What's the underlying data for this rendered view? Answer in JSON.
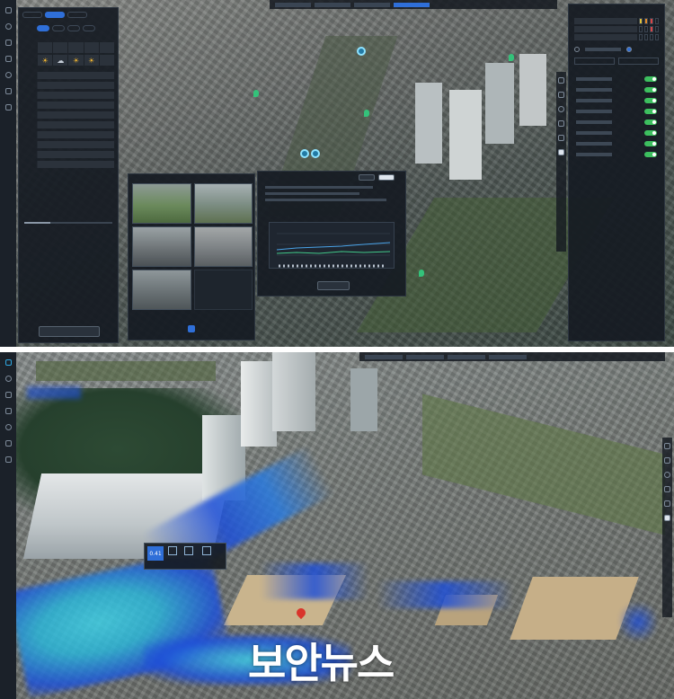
{
  "top_view": {
    "left_panel": {
      "tabs": [
        {
          "label": "",
          "active": false
        },
        {
          "label": "",
          "active": true
        },
        {
          "label": "",
          "active": false
        }
      ],
      "sub_tabs": [
        {
          "label": "",
          "active": true
        },
        {
          "label": "",
          "active": false
        },
        {
          "label": "",
          "active": false
        },
        {
          "label": "",
          "active": false
        }
      ],
      "weather_icons": [
        "sun-cloud-icon",
        "cloud-icon",
        "sun-cloud-icon",
        "sun-cloud-icon"
      ],
      "footer_button": ""
    },
    "cctv_popup": {
      "title": "",
      "cameras": [
        {
          "label": ""
        },
        {
          "label": ""
        },
        {
          "label": ""
        },
        {
          "label": ""
        },
        {
          "label": ""
        }
      ]
    },
    "water_level_popup": {
      "title": "",
      "header_buttons": [
        "",
        ""
      ],
      "legend": "",
      "confirm_button": ""
    },
    "right_panel": {
      "title": "",
      "toggle_count": 8
    }
  },
  "bottom_view": {
    "info_popup": {
      "value": "0.41",
      "caption": ""
    }
  },
  "watermark": "보안뉴스",
  "colors": {
    "panel_bg": "#161b22",
    "accent_blue": "#2f6fd8",
    "toggle_green": "#3dbf5f",
    "flood_blue": "#1e4fd8",
    "flood_cyan": "#3fd0e6"
  }
}
